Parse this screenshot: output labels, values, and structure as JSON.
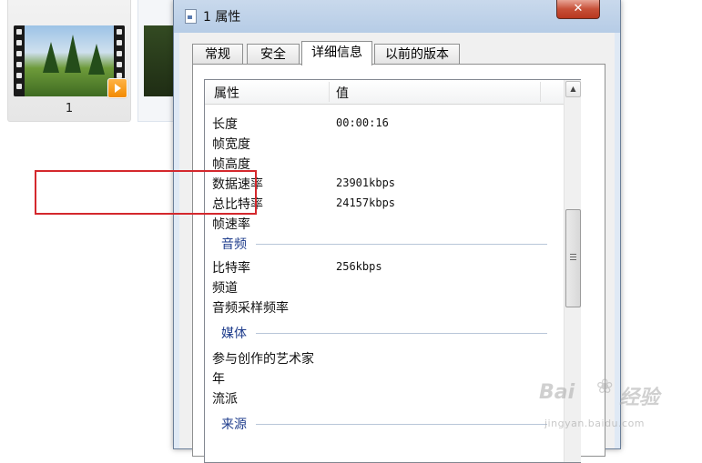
{
  "explorer": {
    "file_name": "1"
  },
  "dialog": {
    "title": "1 属性",
    "close_label": "✕",
    "tabs": [
      {
        "label": "常规"
      },
      {
        "label": "安全"
      },
      {
        "label": "详细信息"
      },
      {
        "label": "以前的版本"
      }
    ],
    "active_tab": "详细信息",
    "columns": {
      "property": "属性",
      "value": "值"
    },
    "video_rows": [
      {
        "label": "长度",
        "value": "00:00:16"
      },
      {
        "label": "帧宽度",
        "value": ""
      },
      {
        "label": "帧高度",
        "value": ""
      },
      {
        "label": "数据速率",
        "value": "23901kbps"
      },
      {
        "label": "总比特率",
        "value": "24157kbps"
      },
      {
        "label": "帧速率",
        "value": ""
      }
    ],
    "groups": {
      "audio": "音频",
      "media": "媒体",
      "source": "来源"
    },
    "audio_rows": [
      {
        "label": "比特率",
        "value": "256kbps"
      },
      {
        "label": "频道",
        "value": ""
      },
      {
        "label": "音频采样频率",
        "value": ""
      }
    ],
    "media_rows": [
      {
        "label": "参与创作的艺术家",
        "value": ""
      },
      {
        "label": "年",
        "value": ""
      },
      {
        "label": "流派",
        "value": ""
      }
    ]
  },
  "watermark": {
    "main": "Bai",
    "main2": "经验",
    "sub": "jingyan.baidu.com"
  },
  "colors": {
    "highlight": "#d4282d",
    "group_title": "#1f3d8c"
  }
}
